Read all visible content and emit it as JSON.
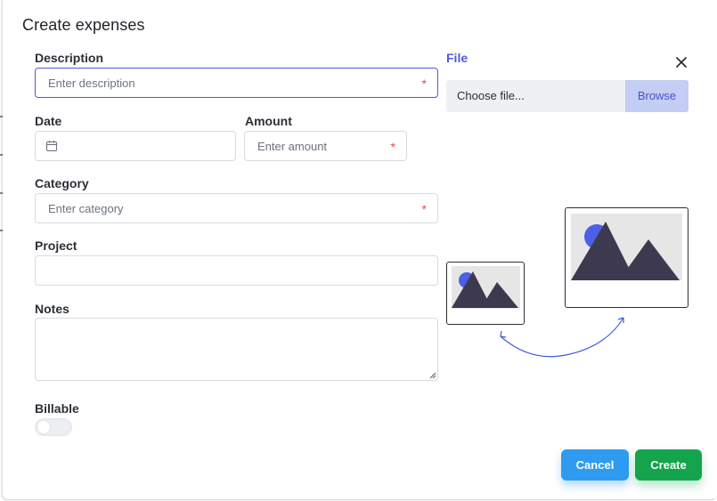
{
  "modal": {
    "title": "Create expenses"
  },
  "fields": {
    "description": {
      "label": "Description",
      "placeholder": "Enter description",
      "required_marker": "*"
    },
    "date": {
      "label": "Date",
      "value": ""
    },
    "amount": {
      "label": "Amount",
      "placeholder": "Enter amount",
      "required_marker": "*"
    },
    "category": {
      "label": "Category",
      "placeholder": "Enter category",
      "required_marker": "*"
    },
    "project": {
      "label": "Project",
      "value": ""
    },
    "notes": {
      "label": "Notes",
      "value": ""
    },
    "billable": {
      "label": "Billable",
      "checked": false
    }
  },
  "file": {
    "label": "File",
    "choose_text": "Choose file...",
    "browse_label": "Browse"
  },
  "icons": {
    "close": "close-icon",
    "calendar": "calendar-icon",
    "image_placeholder": "image-placeholder-icon"
  },
  "actions": {
    "cancel_label": "Cancel",
    "create_label": "Create"
  },
  "colors": {
    "accent": "#4f5bd5",
    "cancel": "#2f9bf0",
    "create": "#14a44d",
    "required": "#e5484d"
  }
}
